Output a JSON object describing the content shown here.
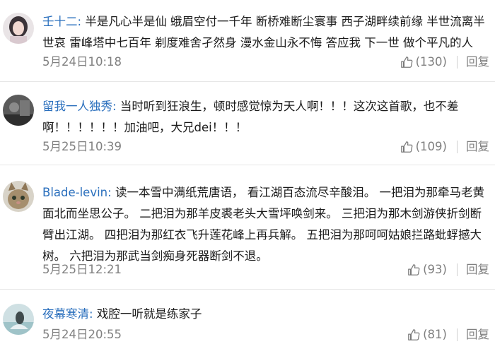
{
  "comments": [
    {
      "user": "壬十二:",
      "text": "半是凡心半是仙 蛾眉空付一千年 断桥难断尘寰事 西子湖畔续前缘 半世流离半世哀 雷峰塔中七百年 剃度难舍孑然身 漫水金山永不悔 答应我 下一世 做个平凡的人",
      "time": "5月24日10:18",
      "likes": "(130)",
      "reply": "回复"
    },
    {
      "user": "留我一人独秀:",
      "text": "当时听到狂浪生，顿时感觉惊为天人啊！！！这次这首歌，也不差啊！！！！！！加油吧，大兄dei！！！",
      "time": "5月25日10:39",
      "likes": "(109)",
      "reply": "回复"
    },
    {
      "user": "Blade-levin:",
      "text": "读一本雪中满纸荒唐语， 看江湖百态流尽辛酸泪。 一把泪为那牵马老黄面北而坐思公子。 二把泪为那羊皮裘老头大雪坪唤剑来。 三把泪为那木剑游侠折剑断臂出江湖。 四把泪为那红衣飞升莲花峰上再兵解。 五把泪为那呵呵姑娘拦路蚍蜉撼大树。 六把泪为那武当剑痴身死器断剑不退。",
      "time": "5月25日12:21",
      "likes": "(93)",
      "reply": "回复"
    },
    {
      "user": "夜幕寒清:",
      "text": "戏腔一听就是练家子",
      "time": "5月24日20:55",
      "likes": "(81)",
      "reply": "回复"
    }
  ],
  "icons": {
    "like": "thumbs-up-icon"
  },
  "colors": {
    "username": "#2a6fbd",
    "meta": "#808080",
    "divider": "#e6e6e6"
  }
}
